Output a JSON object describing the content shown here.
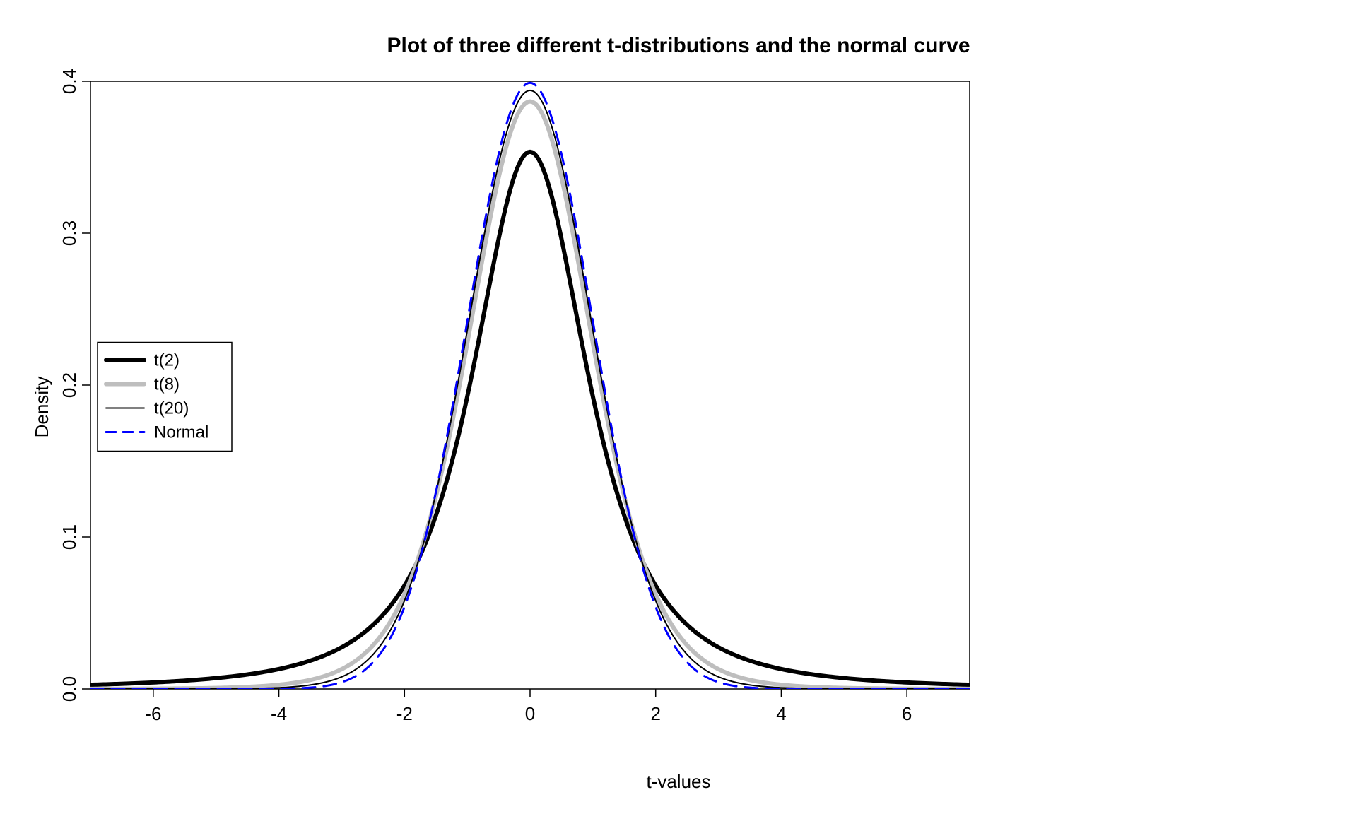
{
  "chart_data": {
    "type": "line",
    "title": "Plot of three different t-distributions and the normal curve",
    "xlabel": "t-values",
    "ylabel": "Density",
    "xlim": [
      -7,
      7
    ],
    "ylim": [
      0,
      0.4
    ],
    "xticks": [
      -6,
      -4,
      -2,
      0,
      2,
      4,
      6
    ],
    "yticks": [
      0.0,
      0.1,
      0.2,
      0.3,
      0.4
    ],
    "x": [
      -7,
      -6.5,
      -6,
      -5.5,
      -5,
      -4.5,
      -4,
      -3.5,
      -3,
      -2.5,
      -2,
      -1.5,
      -1,
      -0.5,
      0,
      0.5,
      1,
      1.5,
      2,
      2.5,
      3,
      3.5,
      4,
      4.5,
      5,
      5.5,
      6,
      6.5,
      7
    ],
    "series": [
      {
        "name": "t(2)",
        "color": "#000000",
        "width": 6,
        "dash": "solid",
        "values": [
          0.0025,
          0.0031,
          0.004,
          0.0053,
          0.0071,
          0.0098,
          0.0138,
          0.02,
          0.0296,
          0.0439,
          0.068,
          0.1037,
          0.1924,
          0.2962,
          0.3536,
          0.2962,
          0.1924,
          0.1037,
          0.068,
          0.0439,
          0.0296,
          0.02,
          0.0138,
          0.0098,
          0.0071,
          0.0053,
          0.004,
          0.0031,
          0.0025
        ]
      },
      {
        "name": "t(8)",
        "color": "#BEBEBE",
        "width": 6,
        "dash": "solid",
        "values": [
          5.5e-05,
          9.7e-05,
          0.00018,
          0.00035,
          0.00072,
          0.00157,
          0.00357,
          0.00835,
          0.02008,
          0.04579,
          0.09107,
          0.17361,
          0.2849,
          0.36071,
          0.38666,
          0.36071,
          0.2849,
          0.17361,
          0.09107,
          0.04579,
          0.02008,
          0.00835,
          0.00357,
          0.00157,
          0.00072,
          0.00035,
          0.00018,
          9.7e-05,
          5.5e-05
        ]
      },
      {
        "name": "t(20)",
        "color": "#000000",
        "width": 2,
        "dash": "solid",
        "values": [
          2.4e-06,
          5.8e-06,
          1.47e-05,
          3.98e-05,
          0.000116,
          0.000364,
          0.00122,
          0.00418,
          0.01424,
          0.04074,
          0.09133,
          0.1784,
          0.29444,
          0.37036,
          0.39581,
          0.37036,
          0.29444,
          0.1784,
          0.09133,
          0.04074,
          0.01424,
          0.00418,
          0.00122,
          0.000364,
          0.000116,
          3.98e-05,
          1.47e-05,
          5.8e-06,
          2.4e-06
        ]
      },
      {
        "name": "Normal",
        "color": "#0000FF",
        "width": 3,
        "dash": "dashed",
        "values": [
          0.0,
          0.0,
          1e-08,
          1.1e-07,
          1.49e-06,
          1.598e-05,
          0.00013383,
          0.00087268,
          0.00443185,
          0.0175283,
          0.05399097,
          0.1295176,
          0.24197072,
          0.35206533,
          0.39894228,
          0.35206533,
          0.24197072,
          0.1295176,
          0.05399097,
          0.0175283,
          0.00443185,
          0.00087268,
          0.00013383,
          1.598e-05,
          1.49e-06,
          1.1e-07,
          1e-08,
          0.0,
          0.0
        ]
      }
    ],
    "legend": {
      "position": "left",
      "items": [
        "t(2)",
        "t(8)",
        "t(20)",
        "Normal"
      ]
    }
  }
}
